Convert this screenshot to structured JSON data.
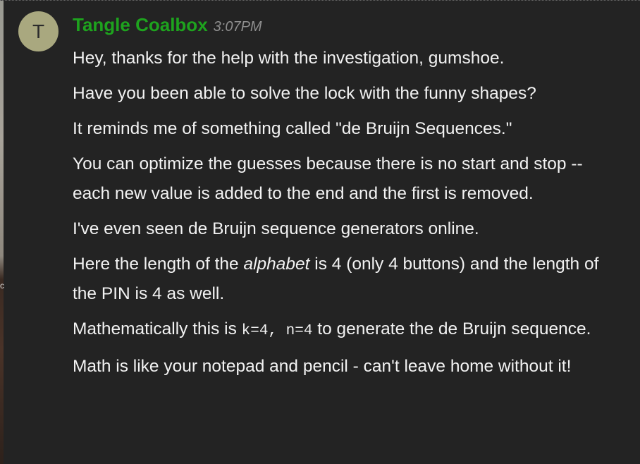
{
  "avatar": {
    "initial": "T",
    "color": "#a9a87f"
  },
  "author": {
    "name": "Tangle Coalbox",
    "color": "#1ea31e"
  },
  "timestamp": "3:07PM",
  "messages": {
    "m1": "Hey, thanks for the help with the investigation, gumshoe.",
    "m2": "Have you been able to solve the lock with the funny shapes?",
    "m3": "It reminds me of something called \"de Bruijn Sequences.\"",
    "m4": "You can optimize the guesses because there is no start and stop -- each new value is added to the end and the first is removed.",
    "m5": "I've even seen de Bruijn sequence generators online.",
    "m6": {
      "pre": "Here the length of the ",
      "em": "alphabet",
      "post": " is 4 (only 4 buttons) and the length of the PIN is 4 as well."
    },
    "m7": {
      "pre": "Mathematically this is ",
      "code": "k=4, n=4",
      "post": " to generate the de Bruijn sequence."
    },
    "m8": "Math is like your notepad and pencil - can't leave home without it!"
  },
  "edge_mark": "c"
}
